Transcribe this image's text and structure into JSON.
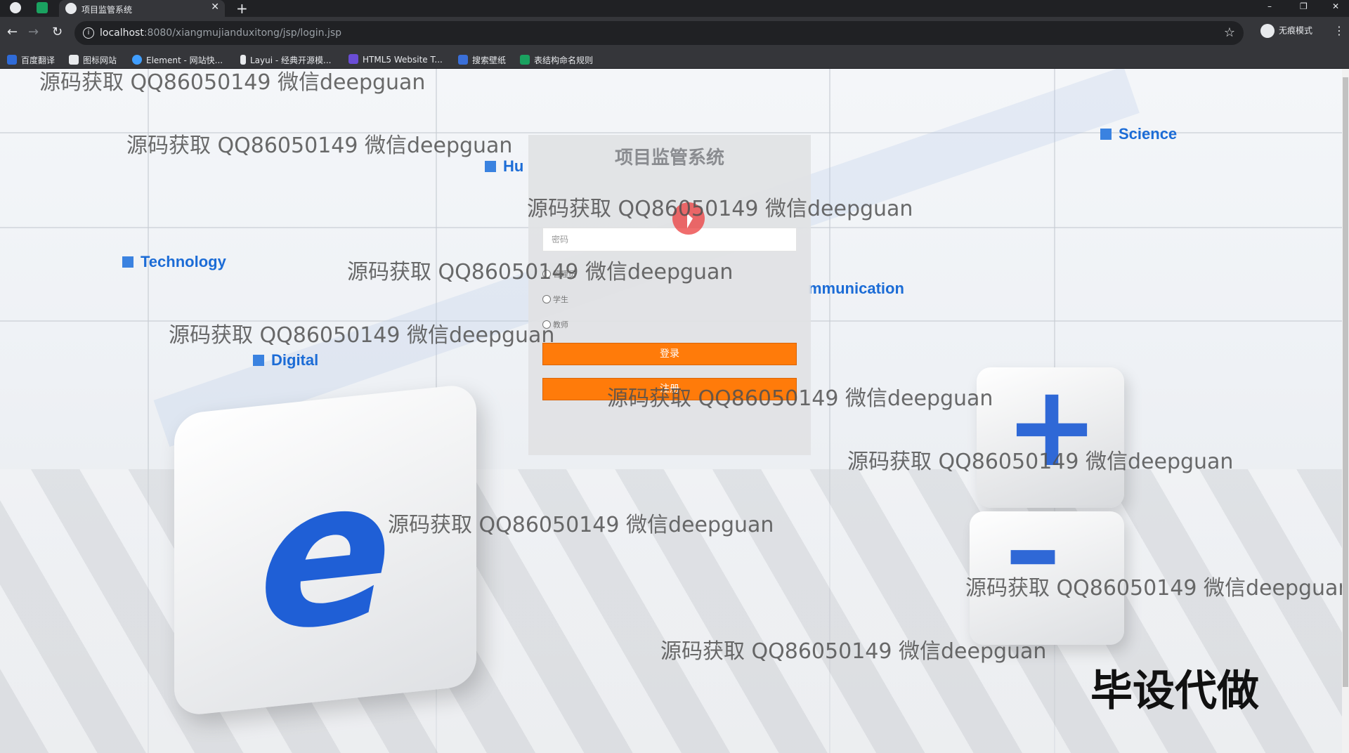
{
  "browser": {
    "tab_title": "项目监管系统",
    "tab_close": "✕",
    "new_tab": "+",
    "url_host": "localhost",
    "url_rest": ":8080/xiangmujianduxitong/jsp/login.jsp",
    "incognito_label": "无痕模式",
    "window_controls": [
      "–",
      "❐",
      "✕"
    ],
    "bookmarks": [
      {
        "label": "百度翻译",
        "icon": "translate-icon",
        "color": "#2f6bd8"
      },
      {
        "label": "图标网站",
        "icon": "flag-icon",
        "color": "#e8eaed"
      },
      {
        "label": "Element - 网站快...",
        "icon": "element-icon",
        "color": "#409eff"
      },
      {
        "label": "Layui - 经典开源模...",
        "icon": "layui-icon",
        "color": "#e8eaed"
      },
      {
        "label": "HTML5 Website T...",
        "icon": "html5-icon",
        "color": "#6a4dd6"
      },
      {
        "label": "搜索壁纸",
        "icon": "wallpaper-icon",
        "color": "#3a6fd8"
      },
      {
        "label": "表结构命名规则",
        "icon": "table-icon",
        "color": "#1aa260"
      }
    ]
  },
  "background": {
    "labels": [
      "Science",
      "Technology",
      "Digital",
      "Hu",
      "mmunication"
    ]
  },
  "login": {
    "title": "项目监管系统",
    "password_placeholder": "密码",
    "roles": [
      "管理员",
      "学生",
      "教师"
    ],
    "login_button": "登录",
    "register_button": "注册"
  },
  "watermark": "源码获取 QQ86050149 微信deepguan",
  "stamp": "毕设代做",
  "colors": {
    "accent": "#ff7b0a",
    "brand_blue": "#1f5fd6"
  }
}
